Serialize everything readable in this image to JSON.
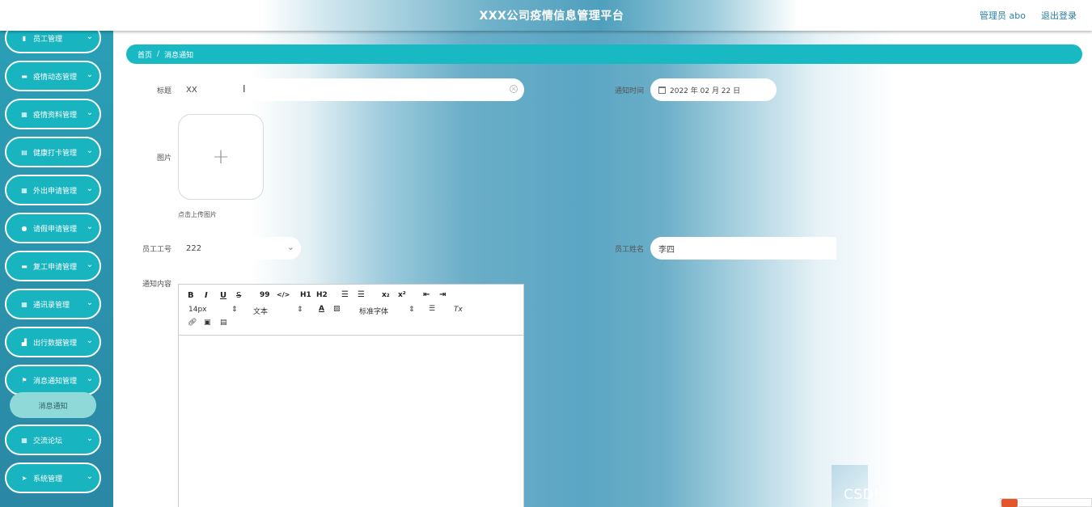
{
  "header": {
    "title": "XXX公司疫情信息管理平台",
    "user": "管理员 abo",
    "logout": "退出登录"
  },
  "sidebar": {
    "items": [
      {
        "label": "员工管理",
        "icon": "bar-chart-icon"
      },
      {
        "label": "疫情动态管理",
        "icon": "monitor-icon"
      },
      {
        "label": "疫情资料管理",
        "icon": "grid-icon"
      },
      {
        "label": "健康打卡管理",
        "icon": "clipboard-icon"
      },
      {
        "label": "外出申请管理",
        "icon": "grid-icon"
      },
      {
        "label": "请假申请管理",
        "icon": "user-icon"
      },
      {
        "label": "复工申请管理",
        "icon": "monitor-icon"
      },
      {
        "label": "通讯录管理",
        "icon": "grid-icon"
      },
      {
        "label": "出行数据管理",
        "icon": "chart-icon"
      },
      {
        "label": "消息通知管理",
        "icon": "flag-icon"
      },
      {
        "label": "交流论坛",
        "icon": "apps-icon"
      },
      {
        "label": "系统管理",
        "icon": "send-icon"
      }
    ],
    "active_sub": "消息通知"
  },
  "breadcrumb": {
    "home": "首页",
    "separator": "/",
    "current": "消息通知"
  },
  "form": {
    "title_label": "标题",
    "title_value": "XX",
    "notify_time_label": "通知时间",
    "notify_time_value": "2022 年 02 月 22 日",
    "image_label": "图片",
    "upload_hint": "点击上传图片",
    "employee_id_label": "员工工号",
    "employee_id_value": "222",
    "employee_name_label": "员工姓名",
    "employee_name_value": "李四",
    "content_label": "通知内容"
  },
  "editor": {
    "font_size": "14px",
    "block_type": "文本",
    "font_family": "标准字体",
    "buttons": {
      "bold": "B",
      "italic": "I",
      "underline": "U",
      "strike": "S",
      "quote": "99",
      "code": "</>",
      "h1": "H1",
      "h2": "H2",
      "sub": "x₂",
      "sup": "x²",
      "color": "A",
      "clean": "Tx"
    }
  },
  "watermark": "CSDN @华信计算机毕设源码程序"
}
